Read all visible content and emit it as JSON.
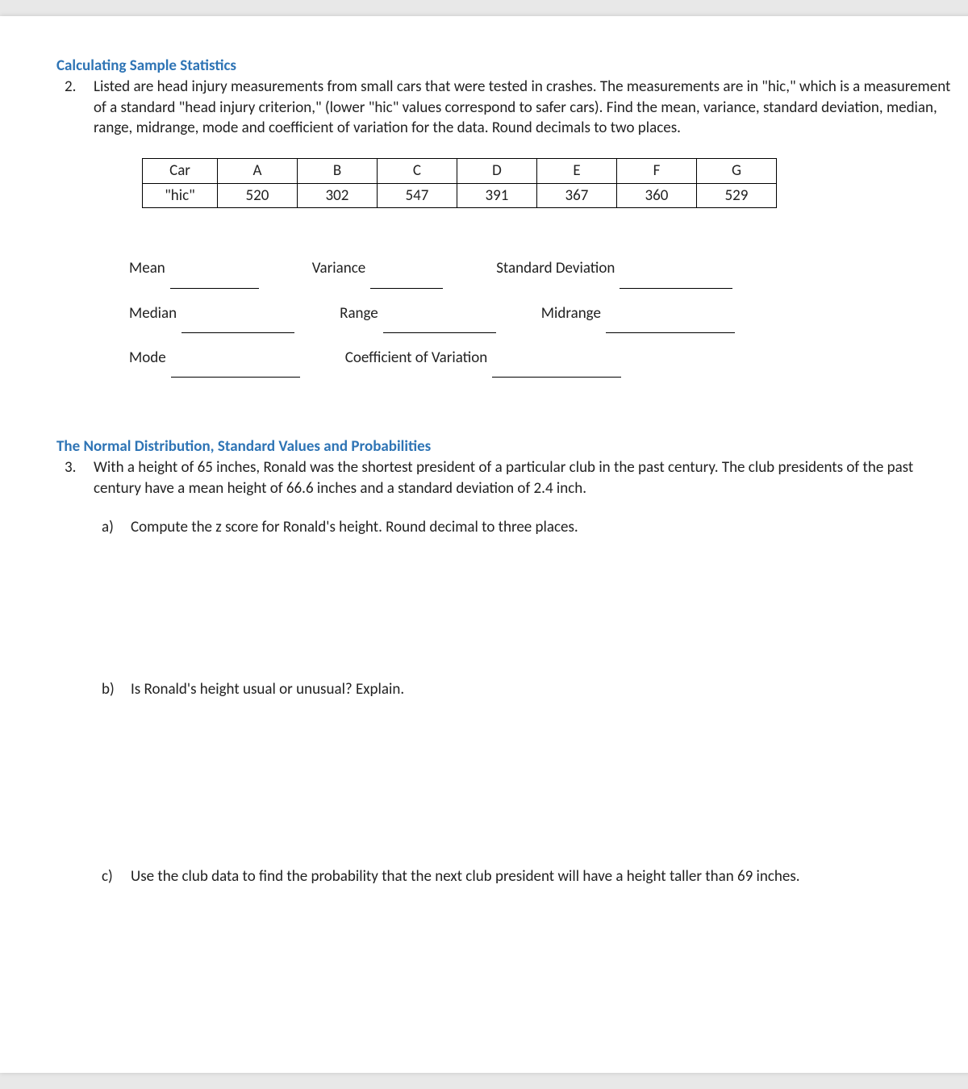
{
  "section1": {
    "title": "Calculating Sample Statistics",
    "q2": {
      "num": "2.",
      "text": "Listed are head injury measurements from small cars that were tested in crashes.  The measurements are in \"hic,\" which is a measurement of a standard \"head injury criterion,\" (lower \"hic\" values correspond to safer cars).   Find the mean, variance, standard deviation, median, range, midrange, mode and coefficient of variation for the data.  Round decimals to two places.",
      "table": {
        "row1": [
          "Car",
          "A",
          "B",
          "C",
          "D",
          "E",
          "F",
          "G"
        ],
        "row2": [
          "\"hic\"",
          "520",
          "302",
          "547",
          "391",
          "367",
          "360",
          "529"
        ]
      },
      "labels": {
        "mean": "Mean",
        "variance": "Variance",
        "stddev": "Standard Deviation",
        "median": "Median",
        "range": "Range",
        "midrange": "Midrange",
        "mode": "Mode",
        "cv": "Coefficient of Variation"
      }
    }
  },
  "section2": {
    "title": "The Normal Distribution, Standard Values and Probabilities",
    "q3": {
      "num": "3.",
      "text": "With a height of 65 inches, Ronald was the shortest president of a particular club in the past century. The club presidents of the past century have a mean height of 66.6 inches and a standard deviation of 2.4 inch.",
      "a": {
        "letter": "a)",
        "text": "Compute the z score for Ronald's height. Round decimal to three places."
      },
      "b": {
        "letter": "b)",
        "text": "Is Ronald's height usual or unusual?  Explain."
      },
      "c": {
        "letter": "c)",
        "text": "Use the club data to find the probability that the next club president will have a height taller than 69 inches."
      }
    }
  }
}
